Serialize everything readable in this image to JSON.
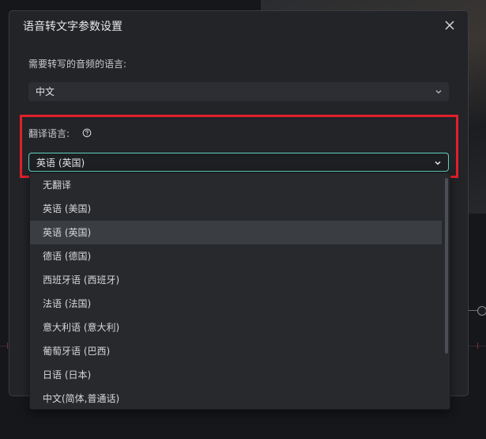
{
  "dialog": {
    "title": "语音转文字参数设置"
  },
  "source_language": {
    "label": "需要转写的音频的语言:",
    "value": "中文"
  },
  "translation": {
    "label": "翻译语言:",
    "value": "英语 (英国)",
    "options": [
      "无翻译",
      "英语 (美国)",
      "英语 (英国)",
      "德语 (德国)",
      "西班牙语 (西班牙)",
      "法语 (法国)",
      "意大利语 (意大利)",
      "葡萄牙语 (巴西)",
      "日语 (日本)",
      "中文(简体,普通话)"
    ],
    "selected_index": 2
  },
  "colors": {
    "accent": "#5fd1c0",
    "highlight": "#e0202a"
  },
  "icons": {
    "close": "close-icon",
    "chevron": "chevron-down-icon",
    "help": "help-circle-icon"
  }
}
